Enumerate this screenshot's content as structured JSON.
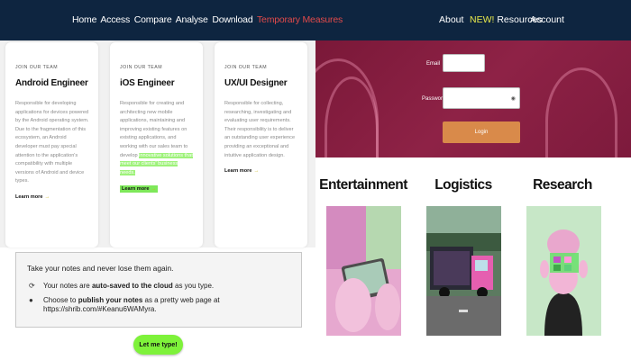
{
  "nav": {
    "left_items": [
      "Home",
      "Access",
      "Compare",
      "Analyse",
      "Download",
      "Temporary Measures"
    ],
    "about": "About",
    "new_badge": "NEW!",
    "resources": "Resources",
    "account": "Account"
  },
  "cards": [
    {
      "kicker": "JOIN OUR TEAM",
      "title": "Android Engineer",
      "desc": "Responsible for developing applications for devices powered by the Android operating system. Due to the fragmentation of this ecosystem, an Android developer must pay special attention to the application's compatibility with multiple versions of Android and device types.",
      "more": "Learn more"
    },
    {
      "kicker": "JOIN OUR TEAM",
      "title": "iOS Engineer",
      "desc": "Responsible for creating and architecting new mobile applications, maintaining and improving existing features on existing applications, and working with our sales team to develop",
      "desc_highlight": "innovative solutions that meet our clients' business needs.",
      "more": "Learn more"
    },
    {
      "kicker": "JOIN OUR TEAM",
      "title": "UX/UI Designer",
      "desc": "Responsible for collecting, researching, investigating and evaluating user requirements. Their responsibility is to deliver an outstanding user experience providing an exceptional and intuitive application design.",
      "more": "Learn more"
    }
  ],
  "notice": {
    "head": "Take your notes and never lose them again.",
    "row1_a": "Your notes are ",
    "row1_b": "auto-saved to the cloud",
    "row1_c": " as you type.",
    "row2_a": "Choose to ",
    "row2_b": "publish your notes",
    "row2_c": " as a pretty web page at https://shrib.com/#Keanu6WAMyra."
  },
  "cta": "Let me type!",
  "login": {
    "email_label": "Email",
    "password_label": "Password",
    "button": "Login"
  },
  "features": [
    "Entertainment",
    "Logistics",
    "Research"
  ],
  "icons": [
    "refresh-icon",
    "globe-icon",
    "eye-icon",
    "arrow-right-icon"
  ],
  "colors": {
    "nav_bg": "#0e2540",
    "nav_highlight": "#e24a4a",
    "new_badge": "#e8e84a",
    "hero_bg": "#8e2246",
    "login_button": "#d98a4a",
    "cta_button": "#7ef23a"
  }
}
